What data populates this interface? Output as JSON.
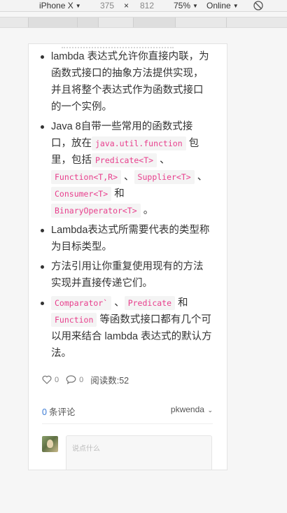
{
  "devtools": {
    "device_name": "iPhone X",
    "width": "375",
    "times": "×",
    "height": "812",
    "zoom": "75%",
    "network": "Online"
  },
  "article": {
    "bullets": [
      {
        "type": "text",
        "text": "lambda 表达式允许你直接内联，为函数式接口的抽象方法提供实现，并且将整个表达式作为函数式接口的一个实例。"
      },
      {
        "type": "rich",
        "parts": [
          {
            "t": "Java 8自带一些常用的函数式接口，放在"
          },
          {
            "c": "java.util.function"
          },
          {
            "t": "包里，包括"
          },
          {
            "c": "Predicate<T>"
          },
          {
            "t": "、"
          },
          {
            "c": "Function<T,R>"
          },
          {
            "t": "、"
          },
          {
            "c": "Supplier<T>"
          },
          {
            "t": "、"
          },
          {
            "c": "Consumer<T>"
          },
          {
            "t": "和"
          },
          {
            "c": "BinaryOperator<T>"
          },
          {
            "t": "。"
          }
        ]
      },
      {
        "type": "text",
        "text": "Lambda表达式所需要代表的类型称为目标类型。"
      },
      {
        "type": "text",
        "text": "方法引用让你重复使用现有的方法实现并直接传递它们。"
      },
      {
        "type": "rich",
        "parts": [
          {
            "c": "Comparator`"
          },
          {
            "t": "、"
          },
          {
            "c": "Predicate"
          },
          {
            "t": "和"
          },
          {
            "c": "Function"
          },
          {
            "t": "等函数式接口都有几个可以用来结合 lambda 表达式的默认方法。"
          }
        ]
      }
    ]
  },
  "stats": {
    "likes": "0",
    "comments": "0",
    "reads": "阅读数:52"
  },
  "comments": {
    "count": "0",
    "count_label": "条评论",
    "user": "pkwenda",
    "placeholder": "说点什么"
  }
}
